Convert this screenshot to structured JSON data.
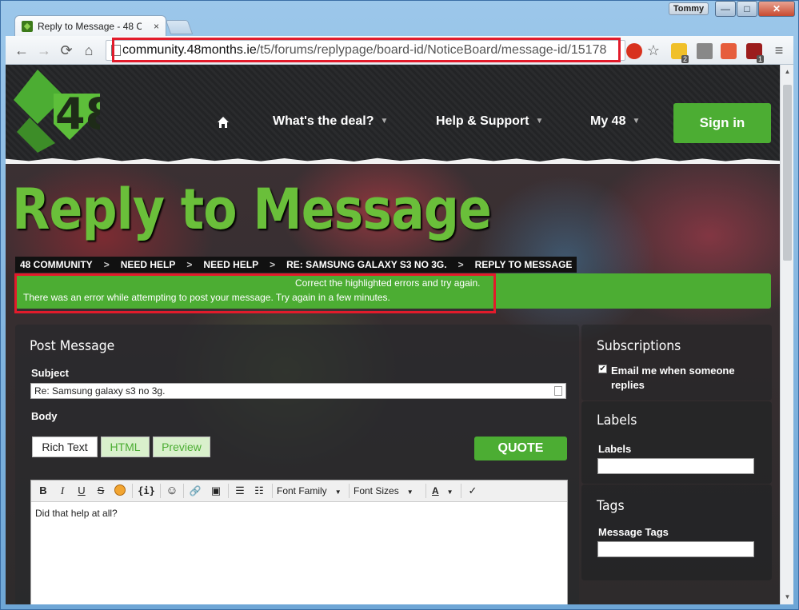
{
  "browser": {
    "tab_title": "Reply to Message - 48 Co",
    "tab_close": "×",
    "user_name": "Tommy",
    "min_label": "—",
    "max_label": "□",
    "close_label": "✕",
    "url_host": "community.48months.ie",
    "url_path": "/t5/forums/replypage/board-id/NoticeBoard/message-id/15178",
    "back_icon": "←",
    "forward_icon": "→",
    "reload_icon": "⟳",
    "home_icon": "⌂",
    "star_icon": "☆",
    "menu_icon": "≡",
    "ext_badges": [
      "2",
      "1"
    ]
  },
  "site": {
    "logo_text": "48",
    "nav": {
      "whats_the_deal": "What's the deal?",
      "help_support": "Help & Support",
      "my48": "My 48",
      "caret": "▼"
    },
    "signin_label": "Sign in"
  },
  "page": {
    "title": "Reply to Message",
    "breadcrumb": [
      "48 COMMUNITY",
      "NEED HELP",
      "NEED HELP",
      "RE: SAMSUNG GALAXY S3 NO 3G.",
      "REPLY TO MESSAGE"
    ],
    "breadcrumb_sep": ">",
    "alert_line1": "Correct the highlighted errors and try again.",
    "alert_line2": "There was an error while attempting to post your message. Try again in a few minutes."
  },
  "post": {
    "heading": "Post Message",
    "subject_label": "Subject",
    "subject_value": "Re: Samsung galaxy s3 no 3g.",
    "body_label": "Body",
    "tabs": {
      "rich": "Rich Text",
      "html": "HTML",
      "preview": "Preview"
    },
    "quote_label": "QUOTE",
    "toolbar": {
      "bold": "B",
      "italic": "I",
      "underline": "U",
      "strike": "S",
      "code": "{i}",
      "emoji": "☺",
      "link": "🔗",
      "image": "▣",
      "ol": "☰",
      "ul": "☷",
      "font_family": "Font Family",
      "font_sizes": "Font Sizes",
      "font_color": "A",
      "spell": "✓"
    },
    "body_text": "Did that help at all?"
  },
  "sidebar": {
    "subscriptions_heading": "Subscriptions",
    "email_label": "Email me when someone replies",
    "email_checked": "✔",
    "labels_heading": "Labels",
    "labels_label": "Labels",
    "tags_heading": "Tags",
    "tags_label": "Message Tags"
  },
  "colors": {
    "brand_green": "#4cad33",
    "title_green": "#6abf3a",
    "highlight_red": "#e21b2b"
  }
}
